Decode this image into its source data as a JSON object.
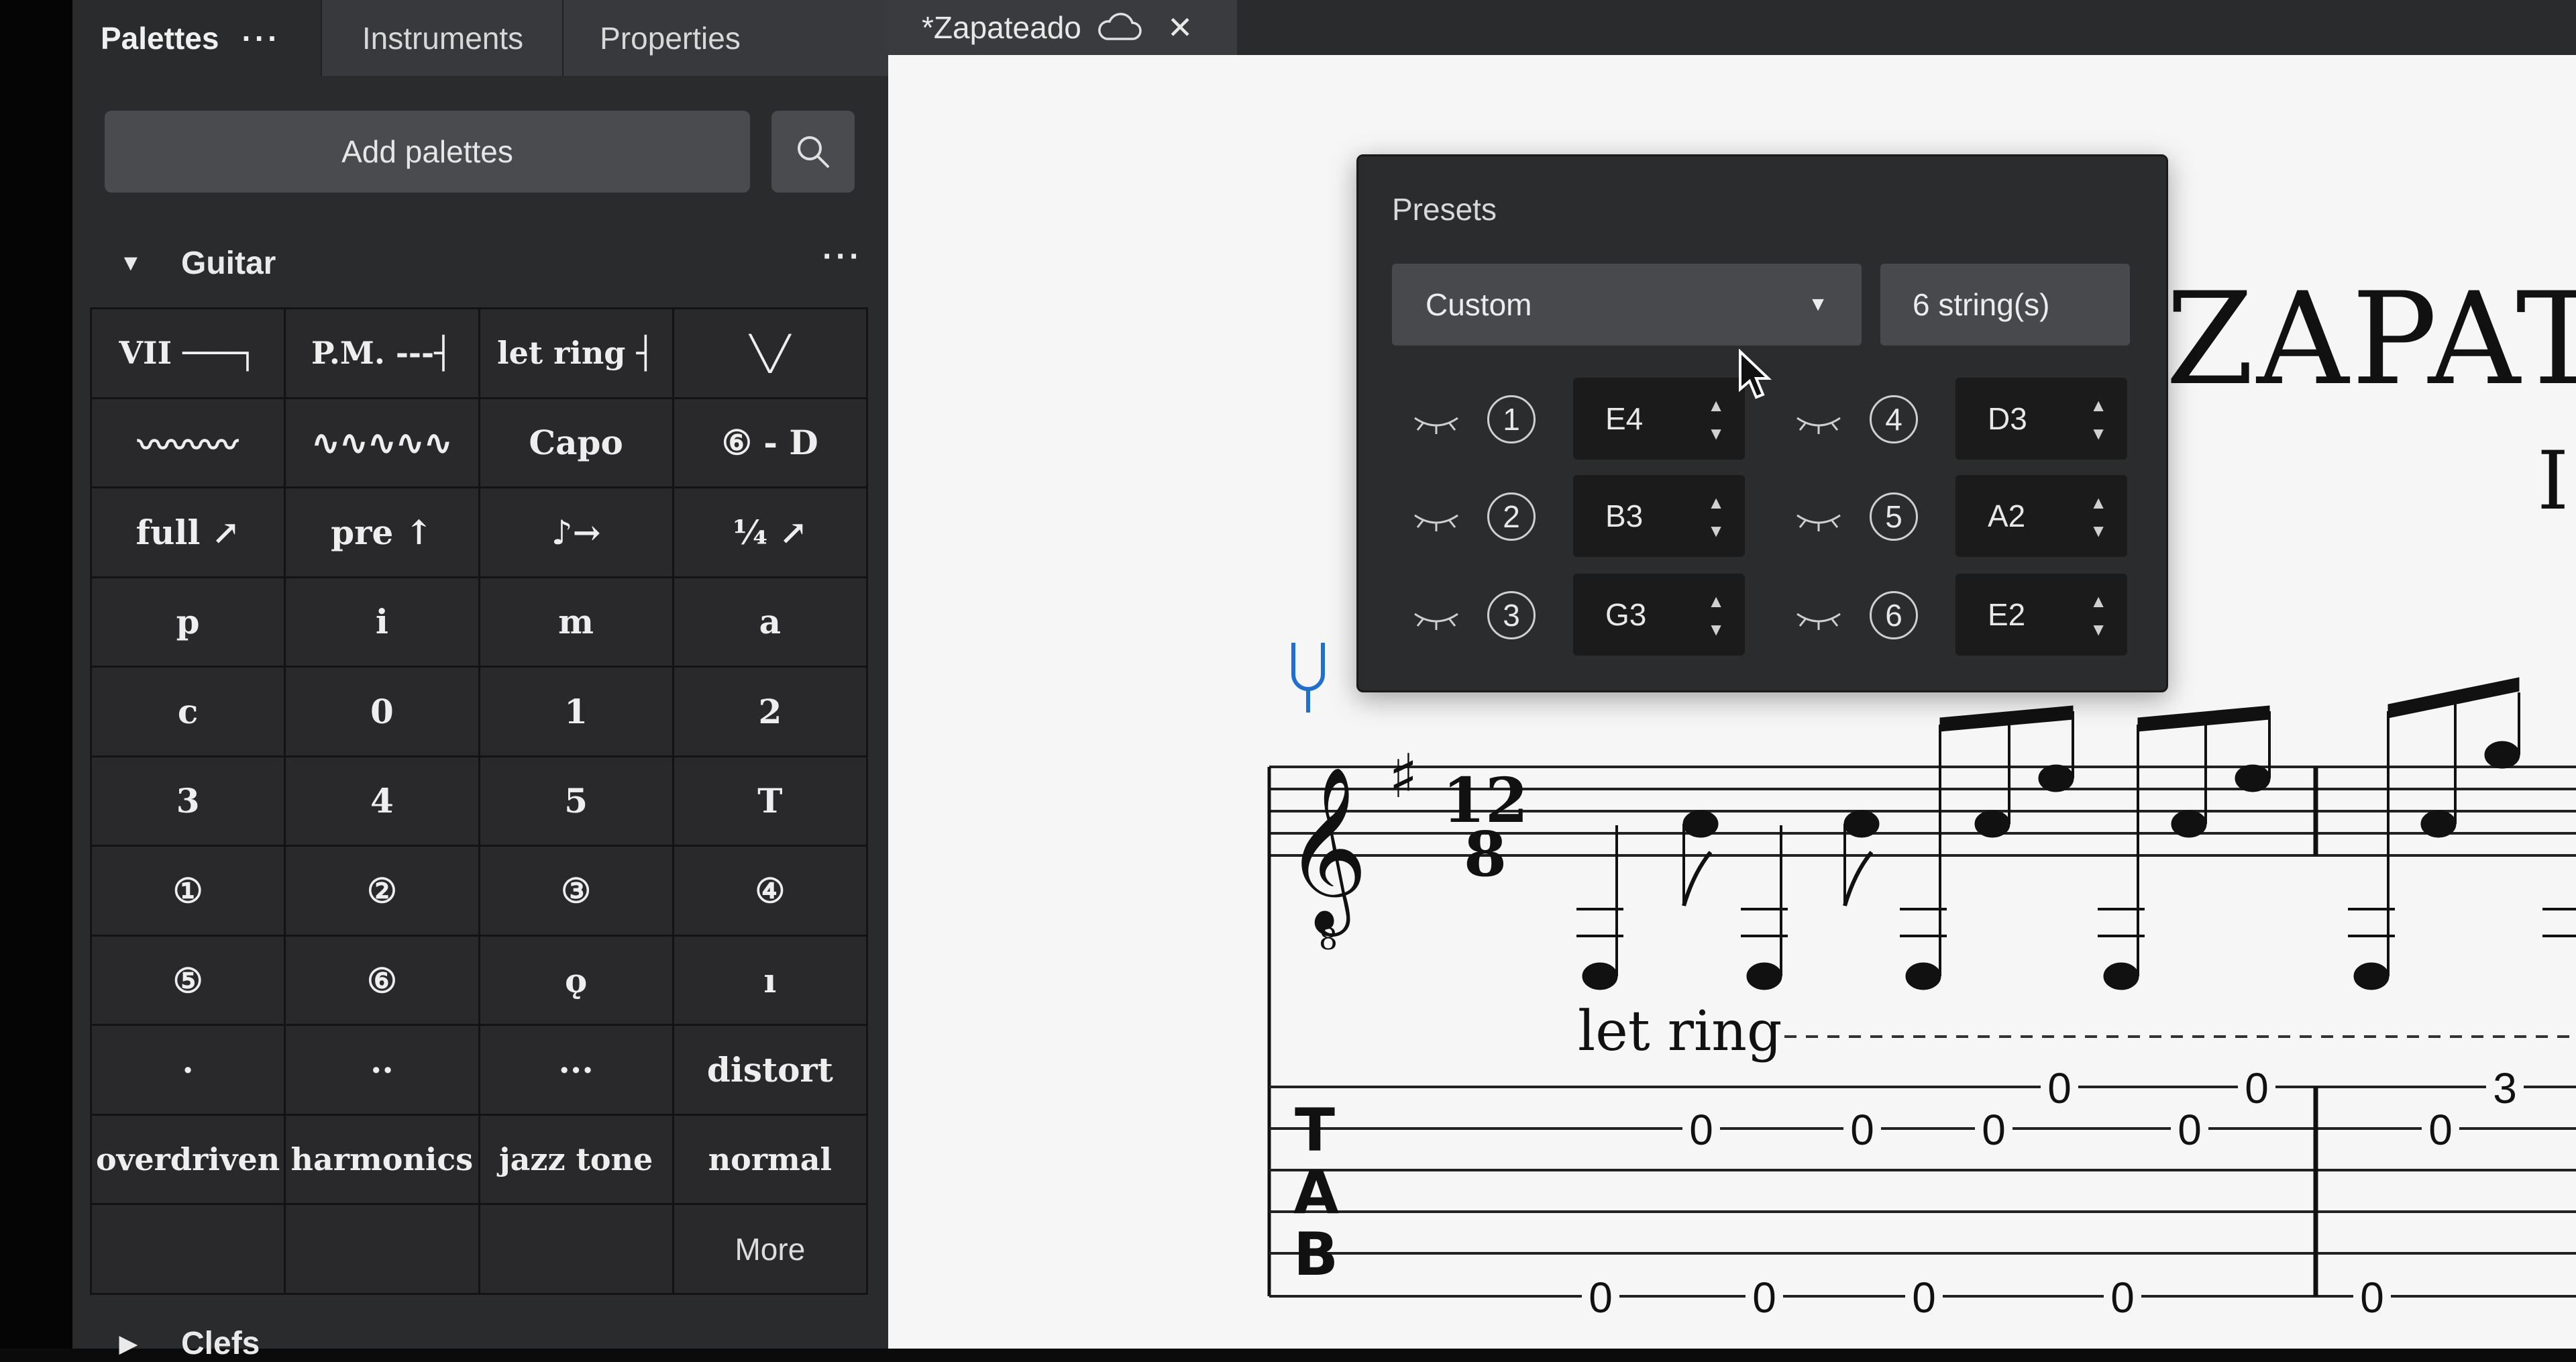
{
  "left_panel": {
    "tabs": [
      {
        "label": "Palettes",
        "more": "···"
      },
      {
        "label": "Instruments"
      },
      {
        "label": "Properties"
      }
    ],
    "add_palettes_label": "Add palettes",
    "guitar": {
      "arrow": "▼",
      "title": "Guitar",
      "more": "···",
      "cells": [
        "VII ───┐",
        "P.M. ---┤",
        "let ring ┤",
        "╲╱",
        "〰〰〰",
        "∿∿∿∿∿",
        "Capo",
        "⑥ - D",
        "full ↗",
        "pre ↑",
        "♪→",
        "¼ ↗",
        "p",
        "i",
        "m",
        "a",
        "c",
        "0",
        "1",
        "2",
        "3",
        "4",
        "5",
        "T",
        "①",
        "②",
        "③",
        "④",
        "⑤",
        "⑥",
        "ǫ",
        "ı",
        "·",
        "··",
        "···",
        "distort",
        "overdriven",
        "harmonics",
        "jazz tone",
        "normal",
        "",
        "",
        "",
        "More"
      ]
    },
    "clefs": {
      "arrow": "▶",
      "title": "Clefs"
    }
  },
  "doc_tab": {
    "title": "*Zapateado",
    "cloud_icon": "cloud-icon",
    "close_icon": "✕"
  },
  "score": {
    "title": "ZAPAT",
    "subtitle": "I",
    "let_ring_text": "let ring",
    "tab_clef": [
      "T",
      "A",
      "B"
    ],
    "tab_numbers_top": [
      "0",
      "0"
    ],
    "tab_numbers_mid": [
      "0",
      "0",
      "0",
      "0",
      "0"
    ],
    "tab_numbers_bottom": [
      "0",
      "0",
      "0",
      "0",
      "0"
    ],
    "tab_number_three": "3"
  },
  "presets": {
    "label": "Presets",
    "selected": "Custom",
    "strings": "6 string(s)",
    "tuning": [
      {
        "num": "1",
        "note": "E4"
      },
      {
        "num": "2",
        "note": "B3"
      },
      {
        "num": "3",
        "note": "G3"
      },
      {
        "num": "4",
        "note": "D3"
      },
      {
        "num": "5",
        "note": "A2"
      },
      {
        "num": "6",
        "note": "E2"
      }
    ]
  },
  "colors": {
    "panel": "#2a2b2d",
    "cell": "#29292b",
    "score_bg": "#f6f6f6",
    "accent_blue": "#1e6fd0"
  }
}
